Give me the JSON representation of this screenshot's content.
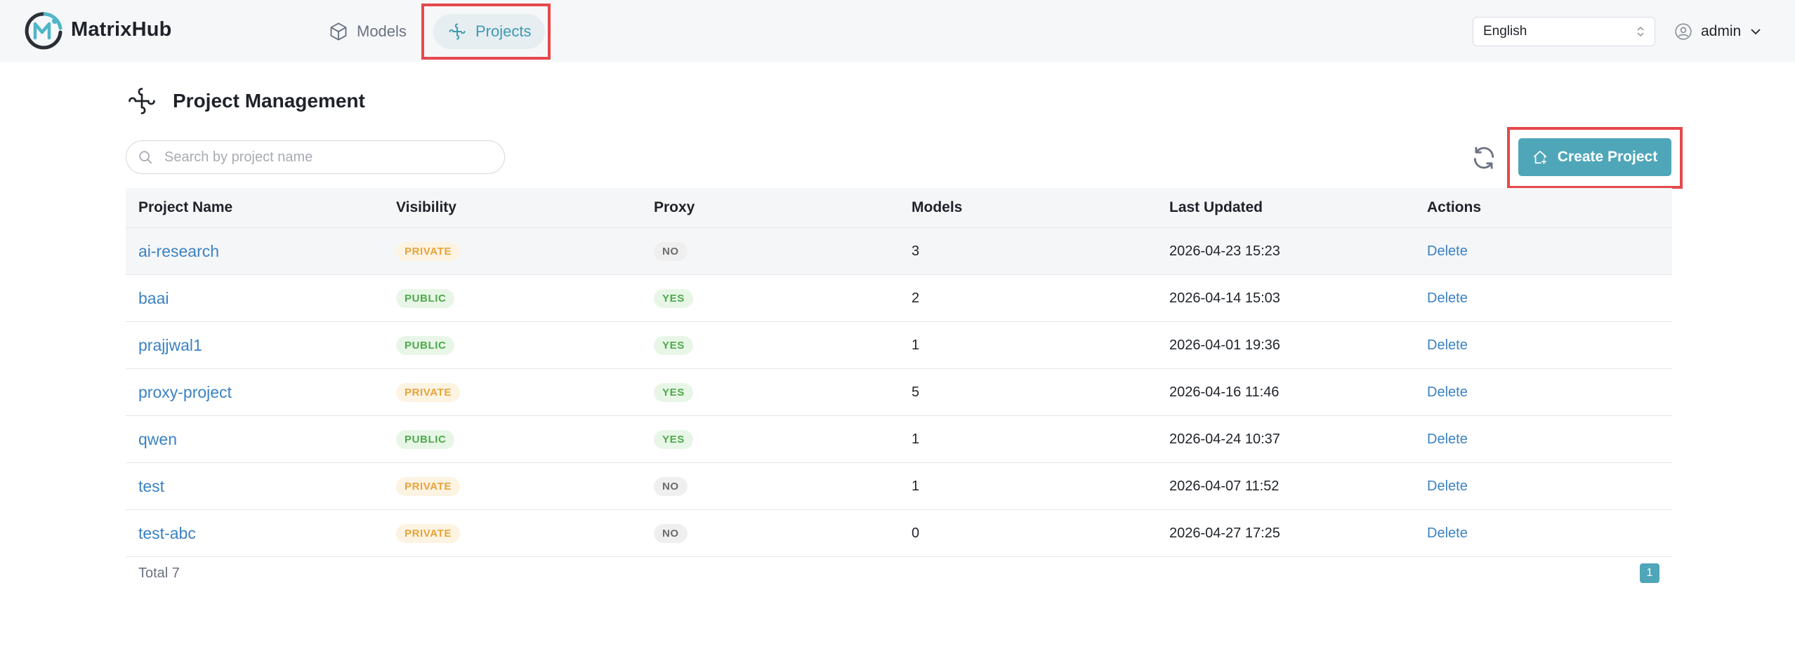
{
  "app": {
    "brand": "MatrixHub"
  },
  "nav": {
    "models_label": "Models",
    "projects_label": "Projects",
    "active": "Projects"
  },
  "header": {
    "language": "English",
    "user": "admin"
  },
  "page": {
    "title": "Project Management",
    "search_placeholder": "Search by project name",
    "create_label": "Create Project"
  },
  "table": {
    "columns": [
      "Project Name",
      "Visibility",
      "Proxy",
      "Models",
      "Last Updated",
      "Actions"
    ],
    "rows": [
      {
        "name": "ai-research",
        "visibility": "PRIVATE",
        "proxy": "NO",
        "models": "3",
        "updated": "2026-04-23 15:23",
        "action": "Delete"
      },
      {
        "name": "baai",
        "visibility": "PUBLIC",
        "proxy": "YES",
        "models": "2",
        "updated": "2026-04-14 15:03",
        "action": "Delete"
      },
      {
        "name": "prajjwal1",
        "visibility": "PUBLIC",
        "proxy": "YES",
        "models": "1",
        "updated": "2026-04-01 19:36",
        "action": "Delete"
      },
      {
        "name": "proxy-project",
        "visibility": "PRIVATE",
        "proxy": "YES",
        "models": "5",
        "updated": "2026-04-16 11:46",
        "action": "Delete"
      },
      {
        "name": "qwen",
        "visibility": "PUBLIC",
        "proxy": "YES",
        "models": "1",
        "updated": "2026-04-24 10:37",
        "action": "Delete"
      },
      {
        "name": "test",
        "visibility": "PRIVATE",
        "proxy": "NO",
        "models": "1",
        "updated": "2026-04-07 11:52",
        "action": "Delete"
      },
      {
        "name": "test-abc",
        "visibility": "PRIVATE",
        "proxy": "NO",
        "models": "0",
        "updated": "2026-04-27 17:25",
        "action": "Delete"
      }
    ]
  },
  "footer": {
    "total": "Total 7",
    "current_page": "1"
  },
  "colors": {
    "accent": "#4fa6b8",
    "link": "#3b82c4",
    "highlight": "#e5484d"
  }
}
